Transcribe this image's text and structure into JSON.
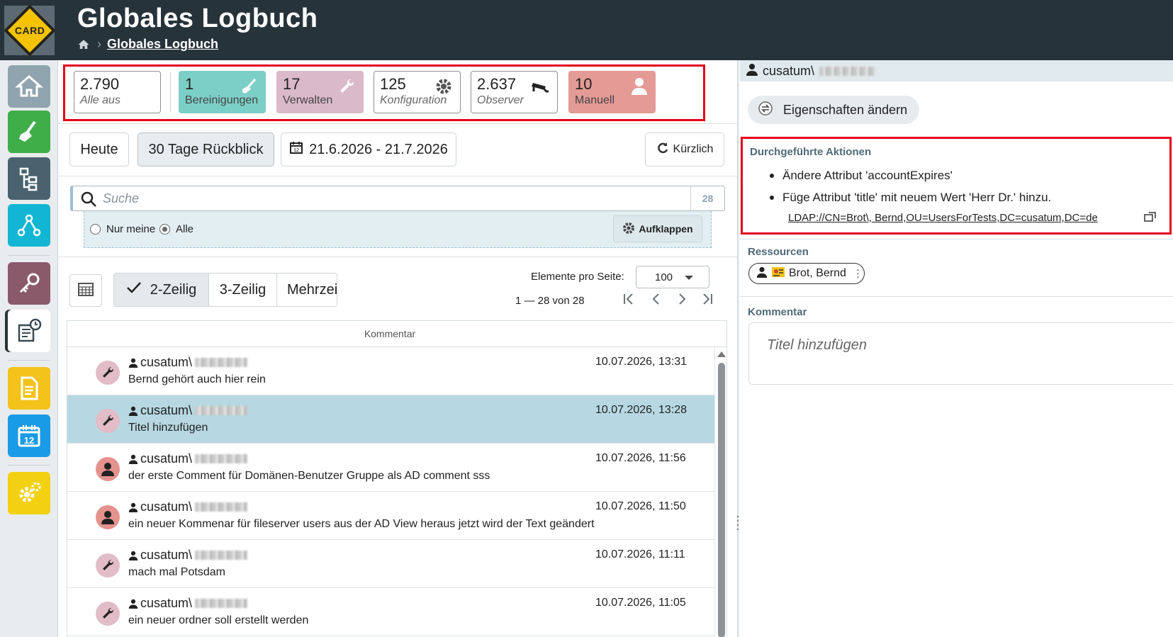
{
  "header": {
    "logo_text": "CARD",
    "title": "Globales Logbuch",
    "breadcrumb": [
      "Globales Logbuch"
    ]
  },
  "sidebar": {
    "items": [
      "home-icon",
      "cleanup-icon",
      "tree-icon",
      "network-icon",
      "key-icon",
      "logbook-icon",
      "document-icon",
      "calendar-icon",
      "gear-icon"
    ]
  },
  "stats": [
    {
      "num": "2.790",
      "label": "Alle aus",
      "color": "#ffffff"
    },
    {
      "num": "1",
      "label": "Bereinigungen",
      "color": "#7ccfc6"
    },
    {
      "num": "17",
      "label": "Verwalten",
      "color": "#dab9c8"
    },
    {
      "num": "125",
      "label": "Konfiguration",
      "color": "#ffffff"
    },
    {
      "num": "2.637",
      "label": "Observer",
      "color": "#ffffff"
    },
    {
      "num": "10",
      "label": "Manuell",
      "color": "#e49a95"
    }
  ],
  "filters": {
    "today": "Heute",
    "range30": "30 Tage Rückblick",
    "dates": "21.6.2026 - 21.7.2026",
    "recent": "Kürzlich"
  },
  "search": {
    "placeholder": "Suche",
    "count": "28",
    "only_mine": "Nur meine",
    "all": "Alle",
    "expand": "Aufklappen"
  },
  "view": {
    "two_line": "2-Zeilig",
    "three_line": "3-Zeilig",
    "multi_line": "Mehrzei",
    "per_page_label": "Elemente pro Seite:",
    "per_page": "100",
    "range": "1 — 28 von 28"
  },
  "table": {
    "column": "Kommentar",
    "rows": [
      {
        "user": "cusatum\\",
        "comment": "Bernd gehört auch hier rein",
        "date": "10.07.2026, 13:31",
        "type": "wrench"
      },
      {
        "user": "cusatum\\",
        "comment": "Titel hinzufügen",
        "date": "10.07.2026, 13:28",
        "type": "wrench"
      },
      {
        "user": "cusatum\\",
        "comment": "der erste Comment für Domänen-Benutzer Gruppe als AD comment sss",
        "date": "10.07.2026, 11:56",
        "type": "person"
      },
      {
        "user": "cusatum\\",
        "comment": "ein neuer Kommenar für fileserver users aus der AD View heraus jetzt wird der Text geändert",
        "date": "10.07.2026, 11:50",
        "type": "person"
      },
      {
        "user": "cusatum\\",
        "comment": "mach mal Potsdam",
        "date": "10.07.2026, 11:11",
        "type": "wrench"
      },
      {
        "user": "cusatum\\",
        "comment": "ein neuer ordner soll erstellt werden",
        "date": "10.07.2026, 11:05",
        "type": "wrench"
      }
    ]
  },
  "detail": {
    "user": "cusatum\\",
    "change_props": "Eigenschaften ändern",
    "actions_title": "Durchgeführte Aktionen",
    "actions": [
      "Ändere Attribut 'accountExpires'",
      "Füge Attribut 'title' mit neuem Wert 'Herr Dr.' hinzu."
    ],
    "ldap": "LDAP://CN=Brot\\, Bernd,OU=UsersForTests,DC=cusatum,DC=de",
    "resources_title": "Ressourcen",
    "resource": "Brot, Bernd",
    "comment_title": "Kommentar",
    "comment_placeholder": "Titel hinzufügen"
  }
}
